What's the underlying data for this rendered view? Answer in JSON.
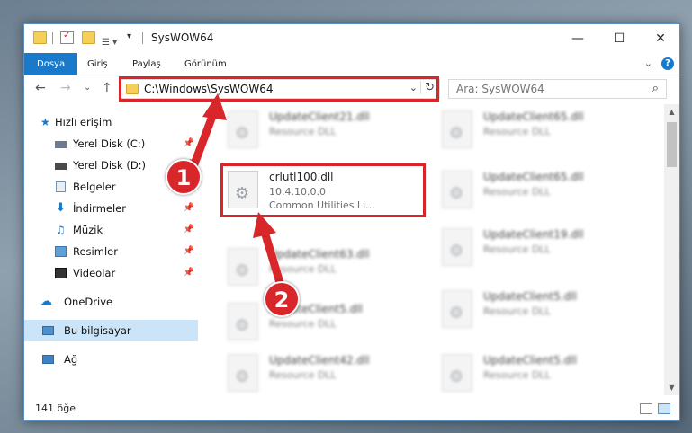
{
  "window": {
    "title": "SysWOW64",
    "minimize": "—",
    "maximize": "☐",
    "close": "✕"
  },
  "ribbon": {
    "tabs": [
      "Dosya",
      "Giriş",
      "Paylaş",
      "Görünüm"
    ],
    "collapse": "⌄",
    "help": "?"
  },
  "nav": {
    "back": "←",
    "forward": "→",
    "recent": "⌄",
    "up": "↑",
    "address": "C:\\Windows\\SysWOW64",
    "address_dropdown": "⌄",
    "refresh": "↻",
    "search_placeholder": "Ara: SysWOW64",
    "search_icon": "⌕"
  },
  "sidebar": {
    "items": [
      {
        "label": "Hızlı erişim",
        "icon": "star-icon",
        "pinned": false
      },
      {
        "label": "Yerel Disk (C:)",
        "icon": "drive-icon",
        "pinned": true
      },
      {
        "label": "Yerel Disk (D:)",
        "icon": "drive-icon",
        "pinned": true
      },
      {
        "label": "Belgeler",
        "icon": "document-icon",
        "pinned": true
      },
      {
        "label": "İndirmeler",
        "icon": "download-icon",
        "pinned": true
      },
      {
        "label": "Müzik",
        "icon": "music-icon",
        "pinned": true
      },
      {
        "label": "Resimler",
        "icon": "picture-icon",
        "pinned": true
      },
      {
        "label": "Videolar",
        "icon": "video-icon",
        "pinned": true
      },
      {
        "label": "OneDrive",
        "icon": "cloud-icon",
        "pinned": false
      },
      {
        "label": "Bu bilgisayar",
        "icon": "computer-icon",
        "pinned": false
      },
      {
        "label": "Ağ",
        "icon": "network-icon",
        "pinned": false
      }
    ]
  },
  "files": {
    "left": [
      {
        "name": "UpdateClient21.dll",
        "desc": "Resource DLL"
      },
      {
        "name": "crlutl100.dll",
        "version": "10.4.10.0.0",
        "desc": "Common Utilities Li..."
      },
      {
        "name": "UpdateClient63.dll",
        "desc": "Resource DLL"
      },
      {
        "name": "UpdateClient5.dll",
        "desc": "Resource DLL"
      },
      {
        "name": "UpdateClient42.dll",
        "desc": "Resource DLL"
      }
    ],
    "right": [
      {
        "name": "UpdateClient65.dll",
        "desc": "Resource DLL"
      },
      {
        "name": "UpdateClient65.dll",
        "desc": "Resource DLL"
      },
      {
        "name": "UpdateClient19.dll",
        "desc": "Resource DLL"
      },
      {
        "name": "UpdateClient5.dll",
        "desc": "Resource DLL"
      },
      {
        "name": "UpdateClient5.dll",
        "desc": "Resource DLL"
      }
    ]
  },
  "status": {
    "count": "141 öğe"
  },
  "annotations": {
    "badge1": "1",
    "badge2": "2",
    "color": "#d9262a"
  },
  "colors": {
    "accent": "#1979ca",
    "selected": "#cce4f7"
  }
}
